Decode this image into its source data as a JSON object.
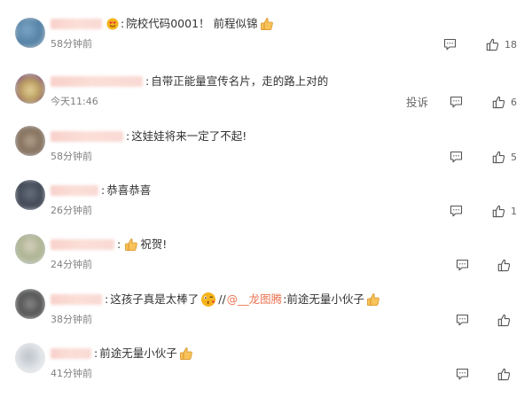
{
  "comments": [
    {
      "text": "院校代码0001！ 前程似锦",
      "time": "58分钟前",
      "likes": "18"
    },
    {
      "text": "自带正能量宣传名片，走的路上对的",
      "time": "今天11:46",
      "report_label": "投诉",
      "likes": "6"
    },
    {
      "text": "这娃娃将来一定了不起!",
      "time": "58分钟前",
      "likes": "5"
    },
    {
      "text": "恭喜恭喜",
      "time": "26分钟前",
      "likes": "1"
    },
    {
      "text": "祝贺!",
      "time": "24分钟前"
    },
    {
      "text": "这孩子真是太棒了",
      "repost_sep": "//",
      "mention": "@__龙图腾",
      "repost_colon": ":",
      "repost_text": "前途无量小伙子",
      "time": "38分钟前"
    },
    {
      "text": "前途无量小伙子",
      "time": "41分钟前"
    }
  ],
  "icons": {
    "reply": "comment-bubble-icon",
    "like": "thumbs-up-icon",
    "emoji_thumbs": "thumbs-up-emoji",
    "emoji_smile": "heart-eyes-emoji",
    "emoji_kiss": "kissing-face-emoji"
  },
  "colors": {
    "mention": "#eb7350",
    "time": "#808080"
  }
}
